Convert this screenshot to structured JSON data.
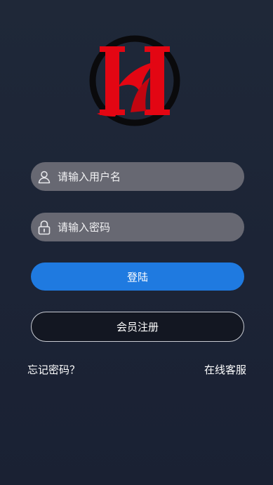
{
  "logo": {
    "alt": "H logo"
  },
  "form": {
    "username": {
      "placeholder": "请输入用户名",
      "value": ""
    },
    "password": {
      "placeholder": "请输入密码",
      "value": ""
    }
  },
  "buttons": {
    "login_label": "登陆",
    "register_label": "会员注册"
  },
  "links": {
    "forgot_password": "忘记密码？",
    "customer_service": "在线客服"
  },
  "colors": {
    "background": "#1d2536",
    "input_bg": "#676872",
    "accent": "#1f7ae0",
    "logo_red": "#e30613"
  },
  "icons": {
    "username": "user-icon",
    "password": "lock-icon"
  }
}
